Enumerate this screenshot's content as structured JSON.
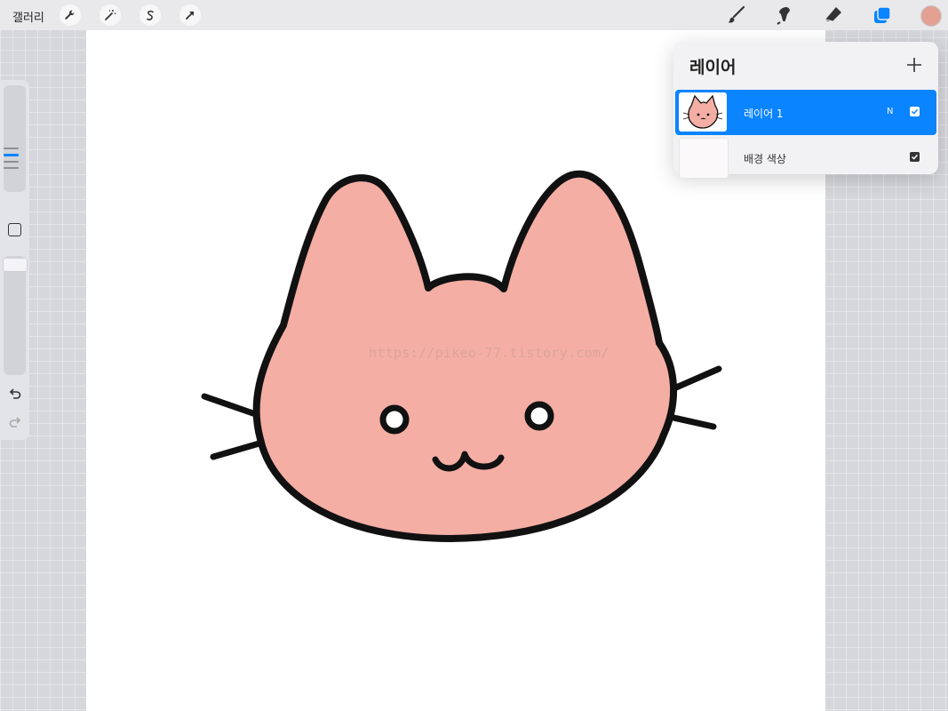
{
  "topbar": {
    "gallery_label": "갤러리",
    "left_tools": [
      "wrench-icon",
      "magic-wand-icon",
      "selection-s-icon",
      "transform-arrow-icon"
    ],
    "right_tools": [
      "brush-icon",
      "smudge-icon",
      "eraser-icon",
      "layers-icon"
    ],
    "active_tool": "layers-icon",
    "current_color": "#e3a194"
  },
  "canvas": {
    "watermark": "https://pikeo-77.tistory.com/",
    "drawing": "pink cat face",
    "fill_color": "#f4aea4",
    "stroke_color": "#111111"
  },
  "sidebar": {
    "controls": [
      "brush-size-slider",
      "modify-button",
      "opacity-slider",
      "undo-icon",
      "redo-icon"
    ]
  },
  "layers_panel": {
    "title": "레이어",
    "add_icon": "plus-icon",
    "layers": [
      {
        "name": "레이어 1",
        "blend_mode": "N",
        "visible": true,
        "selected": true
      },
      {
        "name": "배경 색상",
        "visible": true,
        "selected": false
      }
    ]
  },
  "colors": {
    "accent": "#0a84ff",
    "background": "#d6d7dc",
    "panel": "#f2f2f4"
  }
}
